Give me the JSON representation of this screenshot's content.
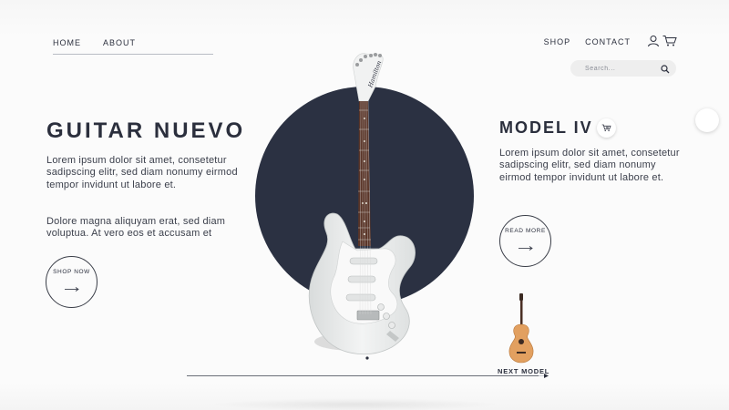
{
  "nav": {
    "left": [
      "HOME",
      "ABOUT"
    ],
    "right": [
      "SHOP",
      "CONTACT"
    ]
  },
  "search": {
    "placeholder": "Search..."
  },
  "hero": {
    "title": "GUITAR NUEVO",
    "paragraph1": "Lorem ipsum dolor sit amet, consetetur sadipscing elitr, sed diam nonumy eirmod tempor invidunt ut labore et.",
    "paragraph2": "Dolore magna aliquyam erat, sed diam voluptua. At vero eos et accusam et",
    "button_label": "SHOP NOW"
  },
  "product": {
    "title": "MODEL IV",
    "description": "Lorem ipsum dolor sit amet, consetetur sadipscing elitr, sed diam nonumy eirmod tempor invidunt ut labore et.",
    "button_label": "READ MORE",
    "headstock_brand": "Hamilton"
  },
  "next": {
    "label": "NEXT MODEL",
    "progress": 0.98
  },
  "colors": {
    "accent_dark": "#2b3142",
    "text": "#2b2f3d",
    "guitar_body": "#e9ebeb",
    "acoustic": "#e2a060"
  },
  "icons": [
    "user-icon",
    "cart-icon",
    "search-icon",
    "arrow-right-icon"
  ]
}
